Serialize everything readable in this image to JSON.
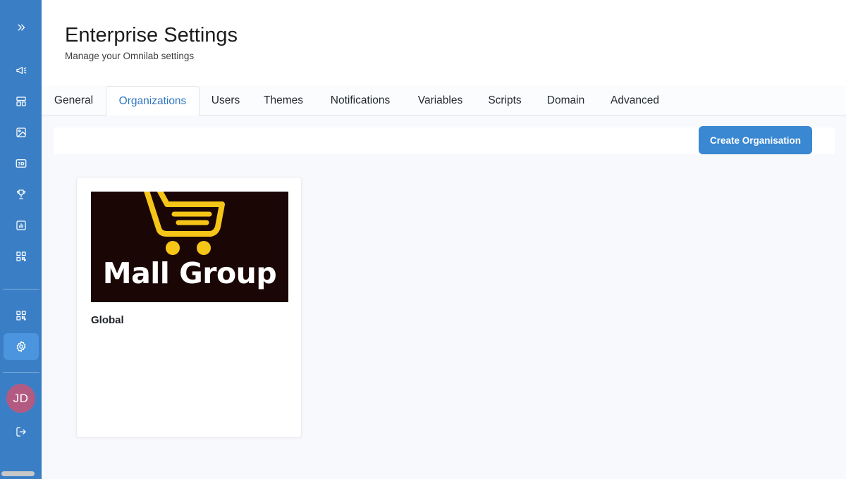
{
  "header": {
    "title": "Enterprise Settings",
    "subtitle": "Manage your Omnilab settings"
  },
  "tabs": [
    {
      "label": "General",
      "active": false
    },
    {
      "label": "Organizations",
      "active": true
    },
    {
      "label": "Users",
      "active": false
    },
    {
      "label": "Themes",
      "active": false
    },
    {
      "label": "Notifications",
      "active": false
    },
    {
      "label": "Variables",
      "active": false
    },
    {
      "label": "Scripts",
      "active": false
    },
    {
      "label": "Domain",
      "active": false
    },
    {
      "label": "Advanced",
      "active": false
    }
  ],
  "toolbar": {
    "create_label": "Create Organisation"
  },
  "organizations": [
    {
      "name": "Global",
      "logo_text": "Mall Group"
    }
  ],
  "sidebar": {
    "items": [
      {
        "icon": "chevrons-right-icon"
      },
      {
        "icon": "megaphone-icon"
      },
      {
        "icon": "layout-icon"
      },
      {
        "icon": "image-icon"
      },
      {
        "icon": "3d-icon",
        "text": "3D"
      },
      {
        "icon": "trophy-icon"
      },
      {
        "icon": "chart-icon"
      },
      {
        "icon": "qr-code-icon"
      },
      {
        "icon": "qr-code-icon"
      },
      {
        "icon": "gear-icon",
        "active": true
      },
      {
        "icon": "logout-icon"
      }
    ],
    "avatar_initials": "JD"
  },
  "colors": {
    "sidebar": "#3a7fc6",
    "accent": "#3a87d2",
    "active_tab_text": "#2f76c0",
    "avatar": "#b25a82",
    "logo_bg": "#1b0606",
    "logo_cart": "#f5c518"
  }
}
